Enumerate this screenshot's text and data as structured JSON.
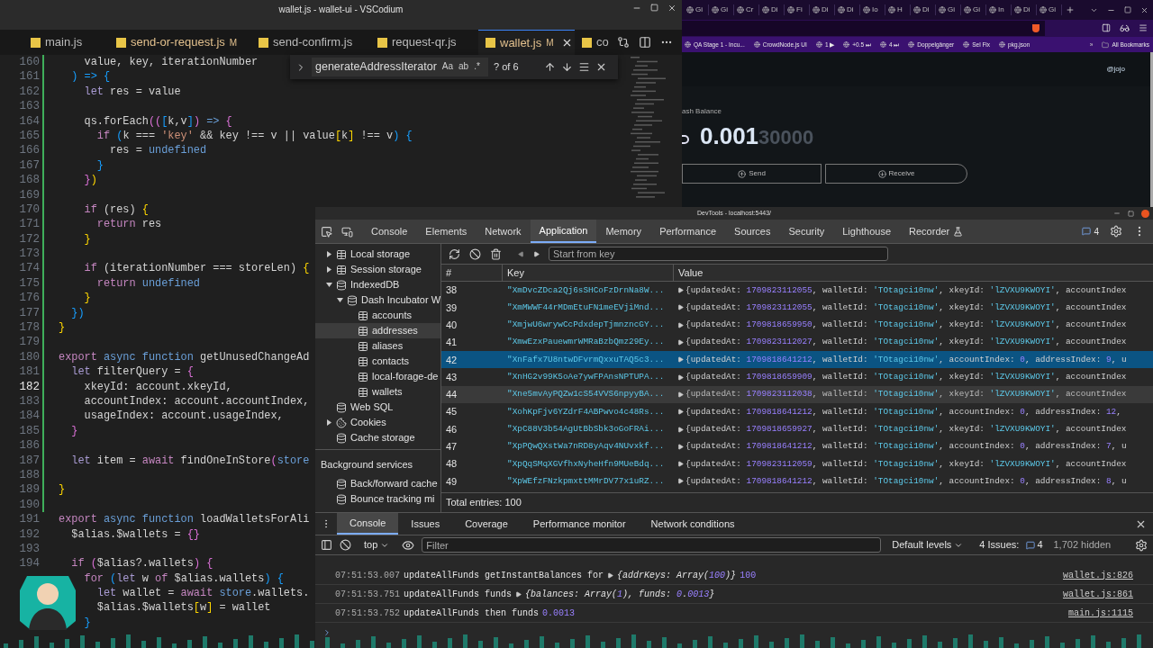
{
  "editor": {
    "title": "wallet.js - wallet-ui - VSCodium",
    "tabs": [
      {
        "label": "main.js",
        "selected": false
      },
      {
        "label": "send-or-request.js",
        "badge": "M",
        "selected": false
      },
      {
        "label": "send-confirm.js",
        "selected": false
      },
      {
        "label": "request-qr.js",
        "selected": false
      },
      {
        "label": "wallet.js",
        "badge": "M",
        "selected": true
      },
      {
        "label": "co",
        "selected": false
      }
    ],
    "find": {
      "value": "generateAddressIterator",
      "options": [
        "Aa",
        "ab",
        ".*"
      ],
      "count": "? of 6"
    },
    "lines": [
      {
        "number": "160",
        "current": false,
        "tokens": [
          {
            "text": "    value, key, iterationNumber",
            "kind": "plain"
          }
        ]
      },
      {
        "number": "161",
        "current": false,
        "tokens": [
          {
            "text": "  ) => {",
            "kind": "b3"
          }
        ]
      },
      {
        "number": "162",
        "current": false,
        "tokens": [
          {
            "text": "    let",
            "kind": "decl"
          },
          {
            "text": " res = value",
            "kind": "plain"
          }
        ]
      },
      {
        "number": "163",
        "current": false
      },
      {
        "number": "164",
        "current": false,
        "tokens": [
          {
            "text": "    qs.forEach",
            "kind": "plain"
          },
          {
            "text": "((",
            "kind": "b2"
          },
          {
            "text": "[",
            "kind": "b3"
          },
          {
            "text": "k,v",
            "kind": "plain"
          },
          {
            "text": "]",
            "kind": "b3"
          },
          {
            "text": ")",
            "kind": "b2"
          },
          {
            "text": " =>",
            "kind": "fn"
          },
          {
            "text": " {",
            "kind": "b2"
          }
        ]
      },
      {
        "number": "165",
        "current": false,
        "tokens": [
          {
            "text": "      if",
            "kind": "kw"
          },
          {
            "text": " (",
            "kind": "b3"
          },
          {
            "text": "k === ",
            "kind": "plain"
          },
          {
            "text": "'key'",
            "kind": "str"
          },
          {
            "text": " && key !== v || value",
            "kind": "plain"
          },
          {
            "text": "[",
            "kind": "b1"
          },
          {
            "text": "k",
            "kind": "plain"
          },
          {
            "text": "]",
            "kind": "b1"
          },
          {
            "text": " !== v",
            "kind": "plain"
          },
          {
            "text": ")",
            "kind": "b3"
          },
          {
            "text": " {",
            "kind": "b3"
          }
        ]
      },
      {
        "number": "166",
        "current": false,
        "tokens": [
          {
            "text": "        res = ",
            "kind": "plain"
          },
          {
            "text": "undefined",
            "kind": "const"
          }
        ]
      },
      {
        "number": "167",
        "current": false,
        "tokens": [
          {
            "text": "      }",
            "kind": "b3"
          }
        ]
      },
      {
        "number": "168",
        "current": false,
        "tokens": [
          {
            "text": "    }",
            "kind": "b2"
          },
          {
            "text": ")",
            "kind": "b1"
          }
        ]
      },
      {
        "number": "169",
        "current": false
      },
      {
        "number": "170",
        "current": false,
        "tokens": [
          {
            "text": "    if",
            "kind": "kw"
          },
          {
            "text": " (res) ",
            "kind": "plain"
          },
          {
            "text": "{",
            "kind": "b1"
          }
        ]
      },
      {
        "number": "171",
        "current": false,
        "tokens": [
          {
            "text": "      return",
            "kind": "kw"
          },
          {
            "text": " res",
            "kind": "plain"
          }
        ]
      },
      {
        "number": "172",
        "current": false,
        "tokens": [
          {
            "text": "    }",
            "kind": "b1"
          }
        ]
      },
      {
        "number": "173",
        "current": false
      },
      {
        "number": "174",
        "current": false,
        "tokens": [
          {
            "text": "    if",
            "kind": "kw"
          },
          {
            "text": " (iterationNumber === storeLen) ",
            "kind": "plain"
          },
          {
            "text": "{",
            "kind": "b1"
          }
        ]
      },
      {
        "number": "175",
        "current": false,
        "tokens": [
          {
            "text": "      return",
            "kind": "kw"
          },
          {
            "text": " undefined",
            "kind": "const"
          }
        ]
      },
      {
        "number": "176",
        "current": false,
        "tokens": [
          {
            "text": "    }",
            "kind": "b1"
          }
        ]
      },
      {
        "number": "177",
        "current": false,
        "tokens": [
          {
            "text": "  })",
            "kind": "b3"
          }
        ]
      },
      {
        "number": "178",
        "current": false,
        "tokens": [
          {
            "text": "}",
            "kind": "b1"
          }
        ]
      },
      {
        "number": "179",
        "current": false
      },
      {
        "number": "180",
        "current": false,
        "tokens": [
          {
            "text": "export",
            "kind": "kw"
          },
          {
            "text": " async function",
            "kind": "fn"
          },
          {
            "text": " getUnusedChangeAd",
            "kind": "plain"
          }
        ]
      },
      {
        "number": "181",
        "current": false,
        "tokens": [
          {
            "text": "  let",
            "kind": "decl"
          },
          {
            "text": " filterQuery = ",
            "kind": "plain"
          },
          {
            "text": "{",
            "kind": "b2"
          }
        ]
      },
      {
        "number": "182",
        "current": true,
        "tokens": [
          {
            "text": "    xkeyId: account.xkeyId,",
            "kind": "plain"
          }
        ]
      },
      {
        "number": "183",
        "current": false,
        "tokens": [
          {
            "text": "    accountIndex: account.accountIndex,",
            "kind": "plain"
          }
        ]
      },
      {
        "number": "184",
        "current": false,
        "tokens": [
          {
            "text": "    usageIndex: account.usageIndex,",
            "kind": "plain"
          }
        ]
      },
      {
        "number": "185",
        "current": false,
        "tokens": [
          {
            "text": "  }",
            "kind": "b2"
          }
        ]
      },
      {
        "number": "186",
        "current": false
      },
      {
        "number": "187",
        "current": false,
        "tokens": [
          {
            "text": "  let",
            "kind": "decl"
          },
          {
            "text": " item = ",
            "kind": "plain"
          },
          {
            "text": "await",
            "kind": "kw"
          },
          {
            "text": " findOneInStore",
            "kind": "plain"
          },
          {
            "text": "(",
            "kind": "b2"
          },
          {
            "text": "store",
            "kind": "const"
          }
        ]
      },
      {
        "number": "188",
        "current": false
      },
      {
        "number": "189",
        "current": false,
        "tokens": [
          {
            "text": "}",
            "kind": "b1"
          }
        ]
      },
      {
        "number": "190",
        "current": false
      },
      {
        "number": "191",
        "current": false,
        "tokens": [
          {
            "text": "export",
            "kind": "kw"
          },
          {
            "text": " async function",
            "kind": "fn"
          },
          {
            "text": " loadWalletsForAli",
            "kind": "plain"
          }
        ]
      },
      {
        "number": "192",
        "current": false,
        "tokens": [
          {
            "text": "  $alias.$wallets = ",
            "kind": "plain"
          },
          {
            "text": "{}",
            "kind": "b2"
          }
        ]
      },
      {
        "number": "193",
        "current": false
      },
      {
        "number": "194",
        "current": false,
        "tokens": [
          {
            "text": "  if",
            "kind": "kw"
          },
          {
            "text": " (",
            "kind": "b2"
          },
          {
            "text": "$alias?.wallets",
            "kind": "plain"
          },
          {
            "text": ")",
            "kind": "b2"
          },
          {
            "text": " {",
            "kind": "b2"
          }
        ]
      },
      {
        "tokens": [
          {
            "text": "    for",
            "kind": "kw"
          },
          {
            "text": " (",
            "kind": "b3"
          },
          {
            "text": "let",
            "kind": "decl"
          },
          {
            "text": " w ",
            "kind": "plain"
          },
          {
            "text": "of",
            "kind": "kw"
          },
          {
            "text": " $alias.wallets",
            "kind": "plain"
          },
          {
            "text": ")",
            "kind": "b3"
          },
          {
            "text": " {",
            "kind": "b3"
          }
        ]
      },
      {
        "tokens": [
          {
            "text": "      let",
            "kind": "decl"
          },
          {
            "text": " wallet = ",
            "kind": "plain"
          },
          {
            "text": "await",
            "kind": "kw"
          },
          {
            "text": " store",
            "kind": "const"
          },
          {
            "text": ".wallets.",
            "kind": "plain"
          }
        ]
      },
      {
        "tokens": [
          {
            "text": "      $alias.$wallets",
            "kind": "plain"
          },
          {
            "text": "[",
            "kind": "b1"
          },
          {
            "text": "w",
            "kind": "plain"
          },
          {
            "text": "]",
            "kind": "b1"
          },
          {
            "text": " = wallet",
            "kind": "plain"
          }
        ]
      },
      {
        "tokens": [
          {
            "text": "    }",
            "kind": "b3"
          }
        ]
      }
    ]
  },
  "browser": {
    "tabs": [
      "Gi",
      "Gi",
      "Cr",
      "Di",
      "Fi",
      "Di",
      "Di",
      "Io",
      "H",
      "Di",
      "Gi",
      "Gi",
      "In",
      "Di",
      "Gi"
    ],
    "bookmarks": [
      "QA Stage 1 - Incu...",
      "CrowdNode.js UI",
      "1 ▶",
      "+0.5 ⏭",
      "4 ⏭",
      "Doppelgänger",
      "Sel Fix",
      "pkg.json"
    ],
    "more": "»",
    "all_bookmarks": "All Bookmarks",
    "user": "@jojo",
    "balance_label": "ash Balance",
    "balance_main": "0.001",
    "balance_rest": "30000",
    "actions": [
      {
        "label": "Send",
        "kind": "send"
      },
      {
        "label": "Receive",
        "kind": "receive"
      }
    ]
  },
  "devtools": {
    "title": "DevTools - localhost:5443/",
    "tabs": [
      {
        "label": "Console",
        "selected": false
      },
      {
        "label": "Elements",
        "selected": false
      },
      {
        "label": "Network",
        "selected": false
      },
      {
        "label": "Application",
        "selected": true
      },
      {
        "label": "Memory",
        "selected": false
      },
      {
        "label": "Performance",
        "selected": false
      },
      {
        "label": "Sources",
        "selected": false
      },
      {
        "label": "Security",
        "selected": false
      },
      {
        "label": "Lighthouse",
        "selected": false
      },
      {
        "label": "Recorder",
        "selected": false
      }
    ],
    "messages_count": "4",
    "tree": [
      {
        "label": "Local storage",
        "kind": "table",
        "expanded": false,
        "selected": false
      },
      {
        "label": "Session storage",
        "kind": "table",
        "expanded": false,
        "selected": false
      },
      {
        "label": "IndexedDB",
        "kind": "database",
        "expanded": true,
        "selected": false,
        "children": [
          {
            "label": "Dash Incubator W",
            "kind": "database",
            "expanded": true,
            "selected": false,
            "children": [
              {
                "label": "accounts",
                "kind": "table",
                "selected": false
              },
              {
                "label": "addresses",
                "kind": "table",
                "selected": true
              },
              {
                "label": "aliases",
                "kind": "table",
                "selected": false
              },
              {
                "label": "contacts",
                "kind": "table",
                "selected": false
              },
              {
                "label": "local-forage-de",
                "kind": "table",
                "selected": false
              },
              {
                "label": "wallets",
                "kind": "table",
                "selected": false
              }
            ]
          }
        ]
      },
      {
        "label": "Web SQL",
        "kind": "database",
        "selected": false
      },
      {
        "label": "Cookies",
        "kind": "cookie",
        "expanded": false,
        "selected": false
      },
      {
        "label": "Cache storage",
        "kind": "database",
        "selected": false
      }
    ],
    "background_heading": "Background services",
    "background": [
      {
        "label": "Back/forward cache",
        "kind": "database",
        "selected": false
      },
      {
        "label": "Bounce tracking mi",
        "kind": "database",
        "selected": false
      }
    ],
    "key_placeholder": "Start from key",
    "columns": [
      "#",
      "Key",
      "Value"
    ],
    "rows": [
      {
        "index": "38",
        "key": "\"XmDvcZDca2Qj6sSHCoFzDrnNa8W...",
        "value": "{updatedAt: 1709823112055, walletId: 'TOtagci10nw', xkeyId: 'lZVXU9KWOYI', accountIndex",
        "selected": false,
        "hovered": false
      },
      {
        "index": "39",
        "key": "\"XmMWWF44rMDmEtuFN1meEVjiMnd...",
        "value": "{updatedAt: 1709823112055, walletId: 'TOtagci10nw', xkeyId: 'lZVXU9KWOYI', accountIndex",
        "selected": false,
        "hovered": false
      },
      {
        "index": "40",
        "key": "\"XmjwU6wrywCcPdxdepTjmnzncGY...",
        "value": "{updatedAt: 1709818659950, walletId: 'TOtagci10nw', xkeyId: 'lZVXU9KWOYI', accountIndex",
        "selected": false,
        "hovered": false
      },
      {
        "index": "41",
        "key": "\"XmwEzxPauewmrWMRaBzbQmz29Ey...",
        "value": "{updatedAt: 1709823112027, walletId: 'TOtagci10nw', xkeyId: 'lZVXU9KWOYI', accountIndex",
        "selected": false,
        "hovered": false
      },
      {
        "index": "42",
        "key": "\"XnFafx7U8ntwDFvrmQxxuTAQ5c3...",
        "value": "{updatedAt: 1709818641212, walletId: 'TOtagci10nw', accountIndex: 0, addressIndex: 9, u",
        "selected": true,
        "hovered": false
      },
      {
        "index": "43",
        "key": "\"XnHG2v99K5oAe7ywFPAnsNPTUPA...",
        "value": "{updatedAt: 1709818659909, walletId: 'TOtagci10nw', xkeyId: 'lZVXU9KWOYI', accountIndex",
        "selected": false,
        "hovered": false
      },
      {
        "index": "44",
        "key": "\"Xne5mvAyPQZw1cS54VVS6npyyBA...",
        "value": "{updatedAt: 1709823112038, walletId: 'TOtagci10nw', xkeyId: 'lZVXU9KWOYI', accountIndex",
        "selected": false,
        "hovered": true
      },
      {
        "index": "45",
        "key": "\"XohKpFjv6YZdrF4ABPwvo4c48Rs...",
        "value": "{updatedAt: 1709818641212, walletId: 'TOtagci10nw', accountIndex: 0, addressIndex: 12,",
        "selected": false,
        "hovered": false
      },
      {
        "index": "46",
        "key": "\"XpC88V3b54AgUtBbSbk3oGoFRAi...",
        "value": "{updatedAt: 1709818659927, walletId: 'TOtagci10nw', xkeyId: 'lZVXU9KWOYI', accountIndex",
        "selected": false,
        "hovered": false
      },
      {
        "index": "47",
        "key": "\"XpPQwQXstWa7nRD8yAqv4NUvxkf...",
        "value": "{updatedAt: 1709818641212, walletId: 'TOtagci10nw', accountIndex: 0, addressIndex: 7, u",
        "selected": false,
        "hovered": false
      },
      {
        "index": "48",
        "key": "\"XpQqSMqXGVfhxNyheHfn9MUeBdq...",
        "value": "{updatedAt: 1709823112059, walletId: 'TOtagci10nw', xkeyId: 'lZVXU9KWOYI', accountIndex",
        "selected": false,
        "hovered": false
      },
      {
        "index": "49",
        "key": "\"XpWEfzFNzkpmxttMMrDV77x1uRZ...",
        "value": "{updatedAt: 1709818641212, walletId: 'TOtagci10nw', accountIndex: 0, addressIndex: 8, u",
        "selected": false,
        "hovered": false
      }
    ],
    "total": "Total entries: 100",
    "drawer_tabs": [
      {
        "label": "Console",
        "selected": true
      },
      {
        "label": "Issues",
        "selected": false
      },
      {
        "label": "Coverage",
        "selected": false
      },
      {
        "label": "Performance monitor",
        "selected": false
      },
      {
        "label": "Network conditions",
        "selected": false
      }
    ],
    "context": "top",
    "filter_placeholder": "Filter",
    "levels": "Default levels",
    "issues_label": "4 Issues:",
    "issues_count": "4",
    "hidden": "1,702 hidden",
    "logs": [
      {
        "time": "07:51:53.007",
        "message": "updateAllFunds getInstantBalances for",
        "object": "{addrKeys: Array(100)}",
        "value": "100",
        "source": "wallet.js:826"
      },
      {
        "time": "07:51:53.751",
        "message": "updateAllFunds funds",
        "object": "{balances: Array(1), funds: 0.0013}",
        "source": "wallet.js:861"
      },
      {
        "time": "07:51:53.752",
        "message": "updateAllFunds then funds",
        "value": "0.0013",
        "source": "main.js:1115"
      }
    ]
  }
}
